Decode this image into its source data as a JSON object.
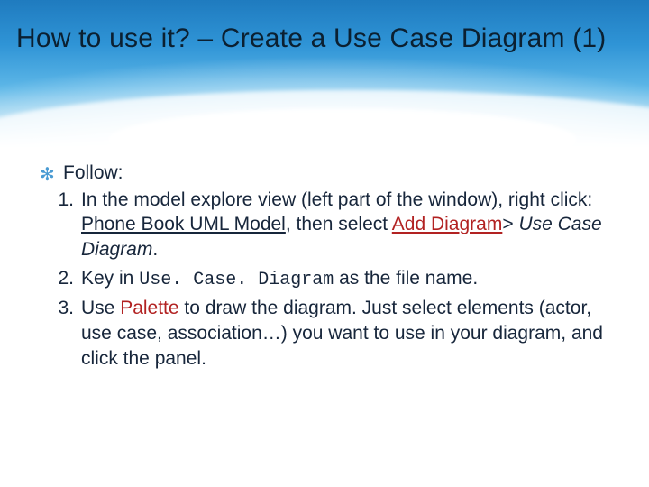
{
  "title": "How to use it? – Create a Use Case Diagram (1)",
  "bullet_glyph": "✻",
  "lead": "Follow:",
  "steps": {
    "s1": {
      "pre": "In the model explore view (left part of the window), right click: ",
      "model_name": "Phone Book UML Model",
      "mid1": ", then select ",
      "add_diagram": "Add Diagram",
      "gt": "> ",
      "ucd": "Use Case Diagram",
      "post": "."
    },
    "s2": {
      "pre": "Key in ",
      "file_name": "Use. Case. Diagram",
      "post": " as the file name."
    },
    "s3": {
      "pre": "Use ",
      "palette": "Palette",
      "post": " to draw the diagram. Just select elements (actor, use case, association…) you want to use in your diagram, and click the panel."
    }
  }
}
